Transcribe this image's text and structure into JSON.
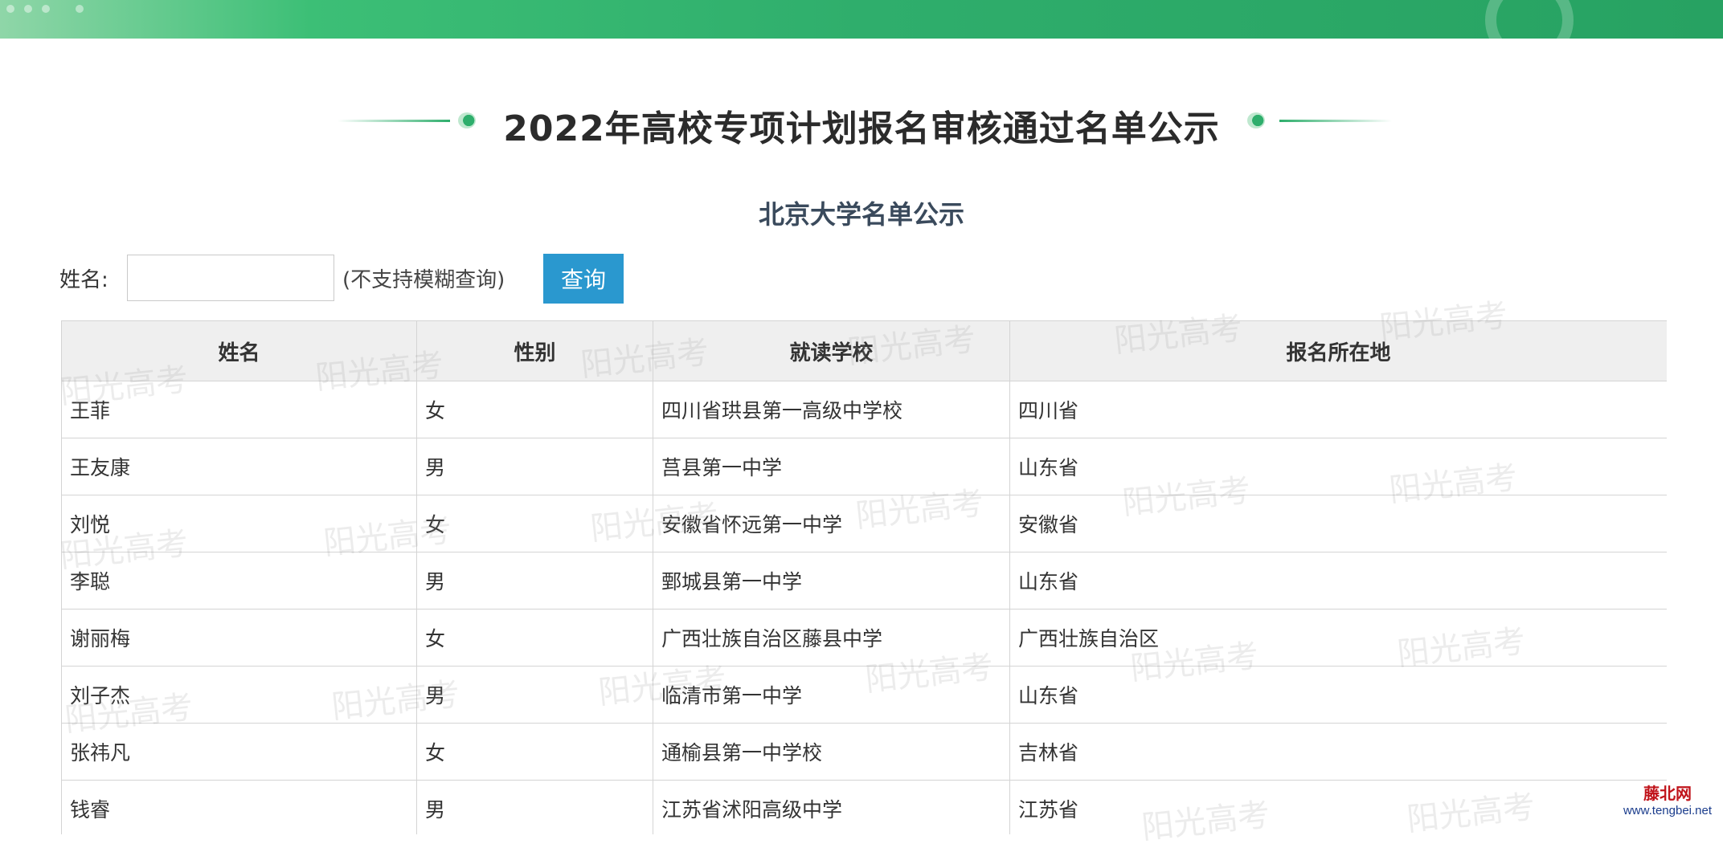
{
  "page": {
    "title": "2022年高校专项计划报名审核通过名单公示",
    "subtitle": "北京大学名单公示"
  },
  "search": {
    "label": "姓名:",
    "value": "",
    "placeholder": "",
    "hint": "(不支持模糊查询)",
    "button_label": "查询"
  },
  "table": {
    "headers": [
      "姓名",
      "性别",
      "就读学校",
      "报名所在地"
    ],
    "rows": [
      [
        "王菲",
        "女",
        "四川省珙县第一高级中学校",
        "四川省"
      ],
      [
        "王友康",
        "男",
        "莒县第一中学",
        "山东省"
      ],
      [
        "刘悦",
        "女",
        "安徽省怀远第一中学",
        "安徽省"
      ],
      [
        "李聪",
        "男",
        "鄄城县第一中学",
        "山东省"
      ],
      [
        "谢丽梅",
        "女",
        "广西壮族自治区藤县中学",
        "广西壮族自治区"
      ],
      [
        "刘子杰",
        "男",
        "临清市第一中学",
        "山东省"
      ],
      [
        "张祎凡",
        "女",
        "通榆县第一中学校",
        "吉林省"
      ],
      [
        "钱睿",
        "男",
        "江苏省沭阳高级中学",
        "江苏省"
      ]
    ]
  },
  "watermark_text": "阳光高考",
  "corner_logo": {
    "name": "藤北网",
    "url": "www.tengbei.net"
  },
  "colors": {
    "banner": "#2fae6c",
    "button": "#2a98cf",
    "header_bg": "#efefef"
  }
}
